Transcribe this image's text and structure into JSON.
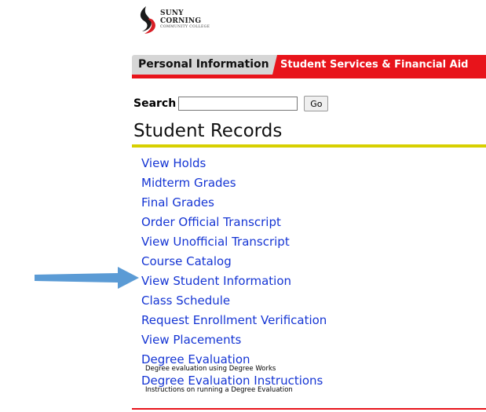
{
  "logo": {
    "line1": "SUNY",
    "line2": "CORNING",
    "line3": "COMMUNITY COLLEGE",
    "colors": {
      "flame": "#d81e25",
      "mark": "#1a1a1a"
    }
  },
  "tabs": [
    {
      "label": "Personal Information",
      "active": false
    },
    {
      "label": "Student Services & Financial Aid",
      "active": true
    }
  ],
  "search": {
    "label": "Search",
    "value": "",
    "button_label": "Go"
  },
  "page_title": "Student Records",
  "menu": [
    {
      "label": "View Holds",
      "description": ""
    },
    {
      "label": "Midterm Grades",
      "description": ""
    },
    {
      "label": "Final Grades",
      "description": ""
    },
    {
      "label": "Order Official Transcript",
      "description": ""
    },
    {
      "label": "View Unofficial Transcript",
      "description": ""
    },
    {
      "label": "Course Catalog",
      "description": ""
    },
    {
      "label": "View Student Information",
      "description": ""
    },
    {
      "label": "Class Schedule",
      "description": ""
    },
    {
      "label": "Request Enrollment Verification",
      "description": ""
    },
    {
      "label": "View Placements",
      "description": ""
    },
    {
      "label": "Degree Evaluation",
      "description": "Degree evaluation using Degree Works"
    },
    {
      "label": "Degree Evaluation Instructions",
      "description": "Instructions on running a Degree Evaluation"
    }
  ],
  "annotation": {
    "arrow_icon": "arrow-right-icon",
    "arrow_color": "#5b9bd5"
  },
  "colors": {
    "tab_active": "#e8141b",
    "tab_inactive": "#d6d6d6",
    "title_rule": "#d7d000",
    "link": "#1535d4"
  }
}
